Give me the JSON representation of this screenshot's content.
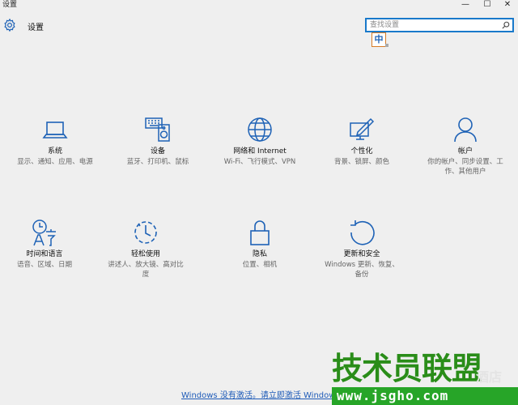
{
  "window": {
    "title": "设置",
    "controls": {
      "minimize": "—",
      "maximize": "☐",
      "close": "✕"
    }
  },
  "header": {
    "title": "设置",
    "icon": "gear-icon"
  },
  "search": {
    "placeholder": "查找设置",
    "icon": "search-icon"
  },
  "ime": {
    "label": "中"
  },
  "tiles": [
    {
      "name": "系统",
      "desc": "显示、通知、应用、电源",
      "icon": "laptop-icon"
    },
    {
      "name": "设备",
      "desc": "蓝牙、打印机、鼠标",
      "icon": "devices-icon"
    },
    {
      "name": "网络和 Internet",
      "desc": "Wi-Fi、飞行模式、VPN",
      "icon": "globe-icon"
    },
    {
      "name": "个性化",
      "desc": "背景、锁屏、颜色",
      "icon": "personalization-icon"
    },
    {
      "name": "帐户",
      "desc": "你的帐户、同步设置、工作、其他用户",
      "icon": "user-icon"
    },
    {
      "name": "时间和语言",
      "desc": "语音、区域、日期",
      "icon": "time-language-icon"
    },
    {
      "name": "轻松使用",
      "desc": "讲述人、放大镜、高对比度",
      "icon": "ease-of-access-icon"
    },
    {
      "name": "隐私",
      "desc": "位置、相机",
      "icon": "lock-icon"
    },
    {
      "name": "更新和安全",
      "desc": "Windows 更新、恢复、备份",
      "icon": "update-icon"
    }
  ],
  "activation": {
    "text": "Windows 没有激活。请立即激活 Windows。"
  },
  "watermark": {
    "main": "技术员联盟",
    "url": "www.jsgho.com",
    "side": "酒店"
  },
  "colors": {
    "accent": "#1e62b6",
    "background": "#efefef",
    "search_border": "#1979ca"
  }
}
